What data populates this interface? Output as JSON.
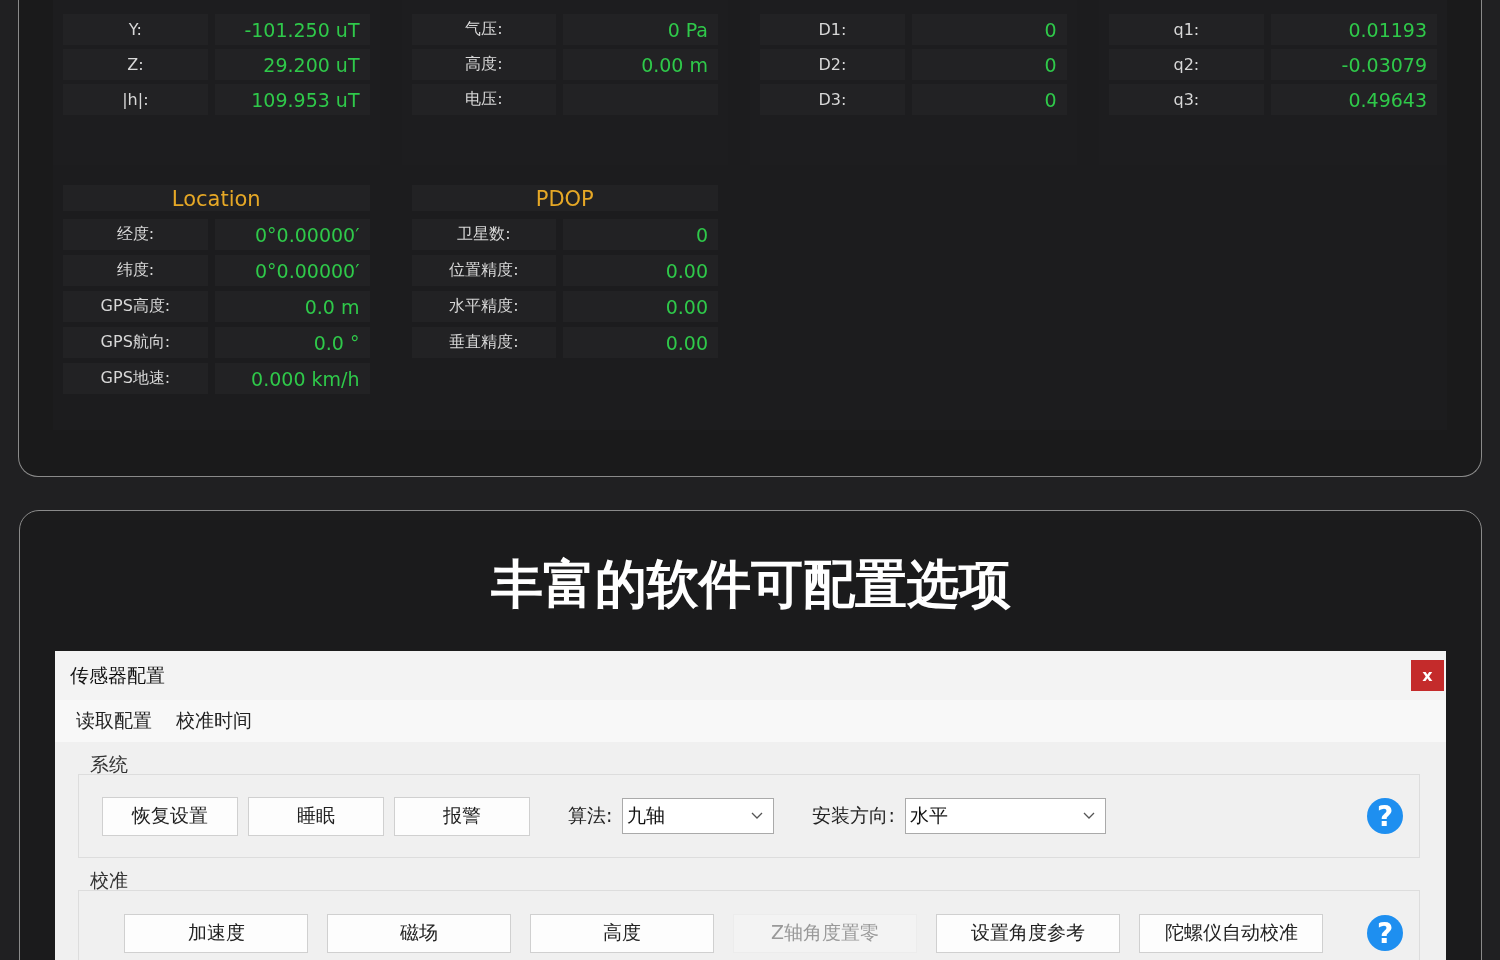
{
  "sensor_panels": [
    {
      "rows": [
        {
          "label": "Y:",
          "value": "-101.250 uT"
        },
        {
          "label": "Z:",
          "value": "29.200 uT"
        },
        {
          "label": "|h|:",
          "value": "109.953 uT"
        }
      ]
    },
    {
      "rows": [
        {
          "label": "气压:",
          "value": "0 Pa"
        },
        {
          "label": "高度:",
          "value": "0.00 m"
        },
        {
          "label": "电压:",
          "value": ""
        }
      ]
    },
    {
      "rows": [
        {
          "label": "D1:",
          "value": "0"
        },
        {
          "label": "D2:",
          "value": "0"
        },
        {
          "label": "D3:",
          "value": "0"
        }
      ]
    },
    {
      "rows": [
        {
          "label": "q1:",
          "value": "0.01193"
        },
        {
          "label": "q2:",
          "value": "-0.03079"
        },
        {
          "label": "q3:",
          "value": "0.49643"
        }
      ]
    }
  ],
  "info_panels": [
    {
      "title": "Location",
      "rows": [
        {
          "label": "经度:",
          "value": "0°0.00000′"
        },
        {
          "label": "纬度:",
          "value": "0°0.00000′"
        },
        {
          "label": "GPS高度:",
          "value": "0.0 m"
        },
        {
          "label": "GPS航向:",
          "value": "0.0 °"
        },
        {
          "label": "GPS地速:",
          "value": "0.000 km/h"
        }
      ]
    },
    {
      "title": "PDOP",
      "rows": [
        {
          "label": "卫星数:",
          "value": "0"
        },
        {
          "label": "位置精度:",
          "value": "0.00"
        },
        {
          "label": "水平精度:",
          "value": "0.00"
        },
        {
          "label": "垂直精度:",
          "value": "0.00"
        }
      ]
    }
  ],
  "heading": "丰富的软件可配置选项",
  "dialog": {
    "title": "传感器配置",
    "close": "x",
    "menu": [
      "读取配置",
      "校准时间"
    ],
    "groups": [
      {
        "title": "系统",
        "help": "?",
        "items": [
          {
            "kind": "button",
            "label": "恢复设置",
            "disabled": false
          },
          {
            "kind": "button",
            "label": "睡眠",
            "disabled": false
          },
          {
            "kind": "button",
            "label": "报警",
            "disabled": false
          },
          {
            "kind": "select",
            "label": "算法:",
            "value": "九轴"
          },
          {
            "kind": "select",
            "label": "安装方向:",
            "value": "水平"
          }
        ]
      },
      {
        "title": "校准",
        "help": "?",
        "items": [
          {
            "kind": "button",
            "label": "加速度",
            "disabled": false
          },
          {
            "kind": "button",
            "label": "磁场",
            "disabled": false
          },
          {
            "kind": "button",
            "label": "高度",
            "disabled": false
          },
          {
            "kind": "button",
            "label": "Z轴角度置零",
            "disabled": true
          },
          {
            "kind": "button",
            "label": "设置角度参考",
            "disabled": false
          },
          {
            "kind": "button",
            "label": "陀螺仪自动校准",
            "disabled": false
          }
        ]
      }
    ]
  }
}
